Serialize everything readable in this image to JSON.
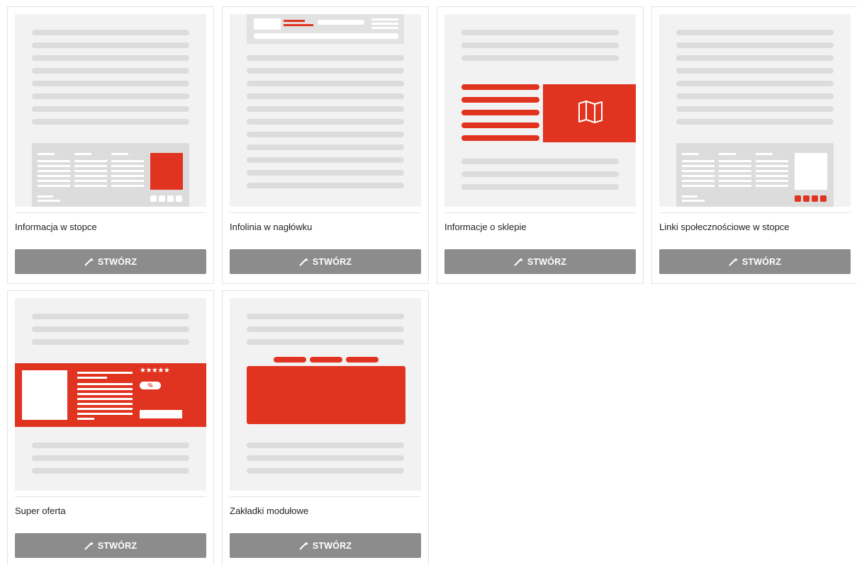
{
  "cards": [
    {
      "title": "Informacja w stopce",
      "button": "STWÓRZ"
    },
    {
      "title": "Infolinia w nagłówku",
      "button": "STWÓRZ"
    },
    {
      "title": "Informacje o sklepie",
      "button": "STWÓRZ"
    },
    {
      "title": "Linki społecznościowe w stopce",
      "button": "STWÓRZ"
    },
    {
      "title": "Super oferta",
      "button": "STWÓRZ"
    },
    {
      "title": "Zakładki modułowe",
      "button": "STWÓRZ"
    }
  ],
  "icons": {
    "button": "magic-wand-icon",
    "map": "map-icon",
    "discount": "percent-badge",
    "rating": "stars"
  },
  "colors": {
    "accent": "#e03420",
    "button_bg": "#8c8c8c",
    "placeholder": "#dcdcdc",
    "preview_bg": "#f2f2f2"
  },
  "preview_text": {
    "discount": "%",
    "stars": "★★★★★"
  }
}
